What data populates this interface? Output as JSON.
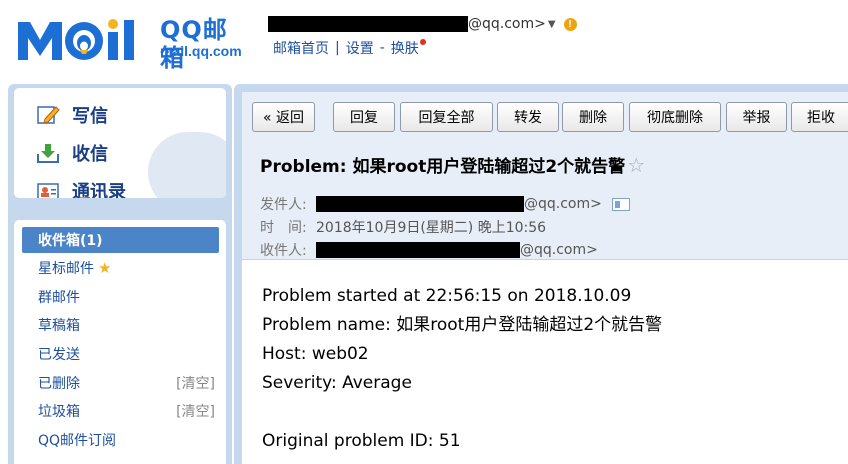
{
  "header": {
    "logo_text": "MOil",
    "logo_cn": "QQ邮箱",
    "logo_url": "mail.qq.com",
    "account_domain": "@qq.com>",
    "account_caret": "▼",
    "warn_icon": "!",
    "nav": [
      "邮箱首页",
      "设置",
      "换肤"
    ],
    "nav_seps": [
      "|",
      "-"
    ]
  },
  "quick": {
    "write": "写信",
    "receive": "收信",
    "contacts": "通讯录"
  },
  "folders": [
    {
      "label": "收件箱(1)"
    },
    {
      "label": "星标邮件"
    },
    {
      "label": "群邮件"
    },
    {
      "label": "草稿箱"
    },
    {
      "label": "已发送"
    },
    {
      "label": "已删除",
      "action": "[清空]"
    },
    {
      "label": "垃圾箱",
      "action": "[清空]"
    },
    {
      "label": "QQ邮件订阅"
    }
  ],
  "toolbar": {
    "back": "« 返回",
    "reply": "回复",
    "reply_all": "回复全部",
    "forward": "转发",
    "delete": "删除",
    "delete_perm": "彻底删除",
    "report": "举报",
    "reject": "拒收"
  },
  "mail": {
    "subject": "Problem: 如果root用户登陆输超过2个就告警",
    "star": "☆",
    "from_label": "发件人:",
    "from_domain": "@qq.com>",
    "time_label": "时　间:",
    "time_value": "2018年10月9日(星期二) 晚上10:56",
    "to_label": "收件人:",
    "to_domain": "@qq.com>",
    "body": [
      "Problem started at 22:56:15 on 2018.10.09",
      "Problem name: 如果root用户登陆输超过2个就告警",
      "Host: web02",
      "Severity: Average",
      "",
      "Original problem ID: 51"
    ]
  },
  "colors": {
    "brand_blue": "#1d6fd6",
    "link_blue": "#1d4f9c",
    "panel_blue": "#c5d8ee",
    "active_folder": "#4c84c8",
    "warning": "#f0a30a"
  }
}
